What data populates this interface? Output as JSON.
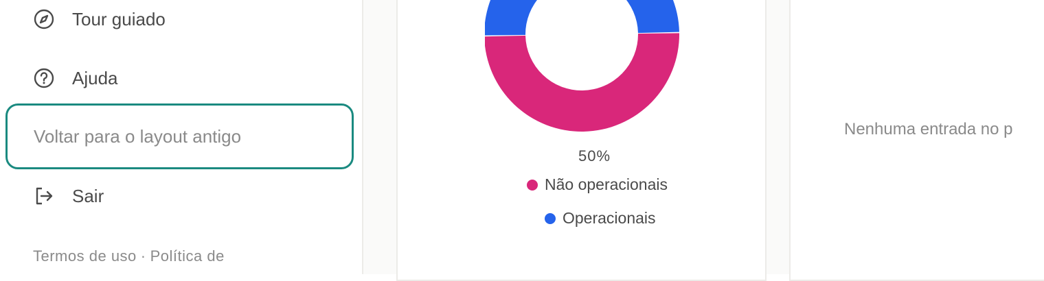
{
  "sidebar": {
    "items": [
      {
        "label": "Tour guiado",
        "icon": "compass-icon"
      },
      {
        "label": "Ajuda",
        "icon": "help-circle-icon"
      }
    ],
    "legacy_layout_label": "Voltar para o layout antigo",
    "logout": {
      "label": "Sair",
      "icon": "logout-icon"
    },
    "footer": {
      "terms": "Termos de uso",
      "separator": "·",
      "privacy": "Política de"
    }
  },
  "chart_data": {
    "type": "pie",
    "categories": [
      "Não operacionais",
      "Operacionais"
    ],
    "values": [
      50,
      50
    ],
    "colors": [
      "#d9277a",
      "#2563eb"
    ],
    "data_labels": [
      "50%"
    ],
    "legend": [
      "Não operacionais",
      "Operacionais"
    ]
  },
  "empty_panel": {
    "message": "Nenhuma entrada no p"
  }
}
